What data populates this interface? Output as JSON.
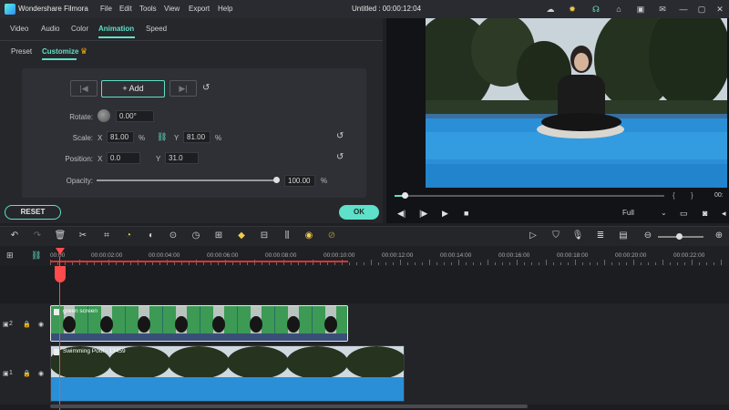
{
  "titlebar": {
    "app_name": "Wondershare Filmora",
    "menus": [
      "File",
      "Edit",
      "Tools",
      "View",
      "Export",
      "Help"
    ],
    "project_title": "Untitled : 00:00:12:04"
  },
  "tabs": [
    {
      "label": "Video",
      "active": false
    },
    {
      "label": "Audio",
      "active": false
    },
    {
      "label": "Color",
      "active": false
    },
    {
      "label": "Animation",
      "active": true
    },
    {
      "label": "Speed",
      "active": false
    }
  ],
  "subtabs": [
    {
      "label": "Preset",
      "active": false
    },
    {
      "label": "Customize",
      "active": true
    }
  ],
  "keyframe": {
    "add_label": "Add",
    "prev_icon": "|◀",
    "next_icon": "▶|"
  },
  "rotate": {
    "label": "Rotate:",
    "value": "0.00°"
  },
  "scale": {
    "label": "Scale:",
    "x_label": "X",
    "x_value": "81.00",
    "x_unit": "%",
    "y_label": "Y",
    "y_value": "81.00",
    "y_unit": "%"
  },
  "position": {
    "label": "Position:",
    "x_label": "X",
    "x_value": "0.0",
    "y_label": "Y",
    "y_value": "31.0"
  },
  "opacity": {
    "label": "Opacity:",
    "value": "100.00",
    "unit": "%",
    "level_percent": 100
  },
  "buttons": {
    "reset": "RESET",
    "ok": "OK"
  },
  "preview": {
    "quality": "Full",
    "scrub_progress_fraction": 0.04,
    "bracket_left": "{",
    "bracket_right": "}",
    "time_partial": "00:"
  },
  "ruler": {
    "times": [
      "00:00",
      "00:00:02:00",
      "00:00:04:00",
      "00:00:06:00",
      "00:00:08:00",
      "00:00:10:00",
      "00:00:12:00",
      "00:00:14:00",
      "00:00:16:00",
      "00:00:18:00",
      "00:00:20:00",
      "00:00:22:00"
    ]
  },
  "tracks": [
    {
      "number": "2",
      "clip_name": "green screen"
    },
    {
      "number": "1",
      "clip_name": "Swimming Pool - 13459"
    }
  ],
  "colors": {
    "accent": "#5fe0c8",
    "playhead": "#ff4b4b",
    "background": "#1f2024"
  }
}
